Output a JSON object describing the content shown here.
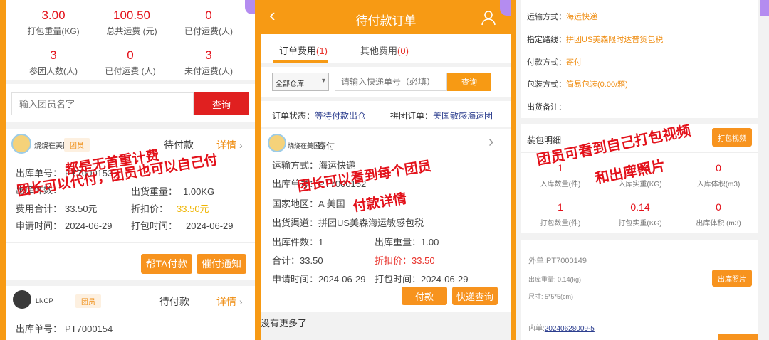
{
  "panel1": {
    "stats_row1": [
      {
        "value": "3.00",
        "label": "打包重量(KG)",
        "color": "#e3111a"
      },
      {
        "value": "100.50",
        "label": "总共运费 (元)",
        "color": "#e3111a"
      },
      {
        "value": "0",
        "label": "已付运费(人)",
        "color": "#e3111a"
      }
    ],
    "stats_row2": [
      {
        "value": "3",
        "label": "参团人数(人)",
        "color": "#e3111a"
      },
      {
        "value": "0",
        "label": "已付运费 (人)",
        "color": "#e3111a"
      },
      {
        "value": "3",
        "label": "未付运费(人)",
        "color": "#e3111a"
      }
    ],
    "search_placeholder": "输入团员名字",
    "search_button": "查询",
    "member1": {
      "name": "烧烧在美国",
      "tag": "团员",
      "status": "待付款",
      "details": "详情",
      "order_label": "出库单号：",
      "order_value": "PT7000153",
      "pieces_label": "出库件数：",
      "weight_label": "出货重量：",
      "weight_value": "1.00KG",
      "fee_label": "费用合计：",
      "fee_value": "33.50元",
      "discount_label": "折扣价：",
      "discount_value": "33.50元",
      "apply_label": "申请时间：",
      "apply_value": "2024-06-29",
      "pack_label": "打包时间：",
      "pack_value": "2024-06-29",
      "pay_for_button": "帮TA付款",
      "remind_button": "催付通知"
    },
    "member2": {
      "name": "LNOP",
      "tag": "团员",
      "status": "待付款",
      "details": "详情",
      "order_label": "出库单号：",
      "order_value": "PT7000154"
    },
    "overlay_line1": "都是无首重计费",
    "overlay_line2": "团长可以代付，团员也可以自己付"
  },
  "panel2": {
    "title": "待付款订单",
    "tab_order_fee": "订单费用",
    "tab_order_count": "(1)",
    "tab_other_fee": "其他费用",
    "tab_other_count": "(0)",
    "warehouse_select": "全部仓库",
    "tracking_placeholder": "请输入快递单号（必填）",
    "query_button": "查询",
    "order_status_label": "订单状态：",
    "order_status_value": "等待付款出仓",
    "group_order_label": "拼团订单：",
    "group_order_value": "美国敏感海运团",
    "member_name": "烧烧在美国",
    "member_status": "寄付",
    "shipping_method_label": "运输方式：",
    "shipping_method_value": "海运快递",
    "order_no_label": "出库单号：",
    "order_no_value": "PT7000152",
    "country_label": "国家地区：",
    "country_value": "A 美国",
    "channel_label": "出货渠道：",
    "channel_value": "拼团US美森海运敏感包税",
    "pieces_label": "出库件数：",
    "pieces_value": "1",
    "weight_label": "出库重量：",
    "weight_value": "1.00",
    "total_label": "合计：",
    "total_value": "33.50",
    "discount_label": "折扣价：",
    "discount_value": "33.50",
    "apply_label": "申请时间：",
    "apply_value": "2024-06-29",
    "pack_label": "打包时间：",
    "pack_value": "2024-06-29",
    "pay_button": "付款",
    "express_button": "快递查询",
    "no_more": "没有更多了",
    "overlay_line1": "团长可以看到每个团员",
    "overlay_line2": "付款详情"
  },
  "panel3": {
    "shipping_label": "运输方式：",
    "shipping_value": "海运快递",
    "route_label": "指定路线：",
    "route_value": "拼团US美森限时达普货包税",
    "payment_label": "付款方式：",
    "payment_value": "寄付",
    "packing_label": "包装方式：",
    "packing_value": "简易包装(0.00/箱)",
    "remark_label": "出货备注：",
    "packing_detail_title": "装包明细",
    "packing_video_button": "打包视频",
    "metrics_row1": [
      {
        "value": "1",
        "label": "入库数量(件)"
      },
      {
        "value": "0.44",
        "label": "入库实重(KG)"
      },
      {
        "value": "0",
        "label": "入库体积(m3)"
      }
    ],
    "metrics_row2": [
      {
        "value": "1",
        "label": "打包数量(件)"
      },
      {
        "value": "0.14",
        "label": "打包实重(KG)"
      },
      {
        "value": "0",
        "label": "出库体积 (m3)"
      }
    ],
    "outer_no": "外单:PT7000149",
    "out_weight": "出库重量: 0.14(kg)",
    "size": "尺寸: 5*5*5(cm)",
    "photo_button": "出库照片",
    "inner_label": "内单:",
    "inner_value": "20240628009-5",
    "overlay_line1": "团员可看到自己打包视频",
    "overlay_line2": "和出库照片"
  },
  "colors": {
    "background": "#f79a14",
    "accent": "#f7931e",
    "red": "#e3111a",
    "header": "#f79a14"
  }
}
